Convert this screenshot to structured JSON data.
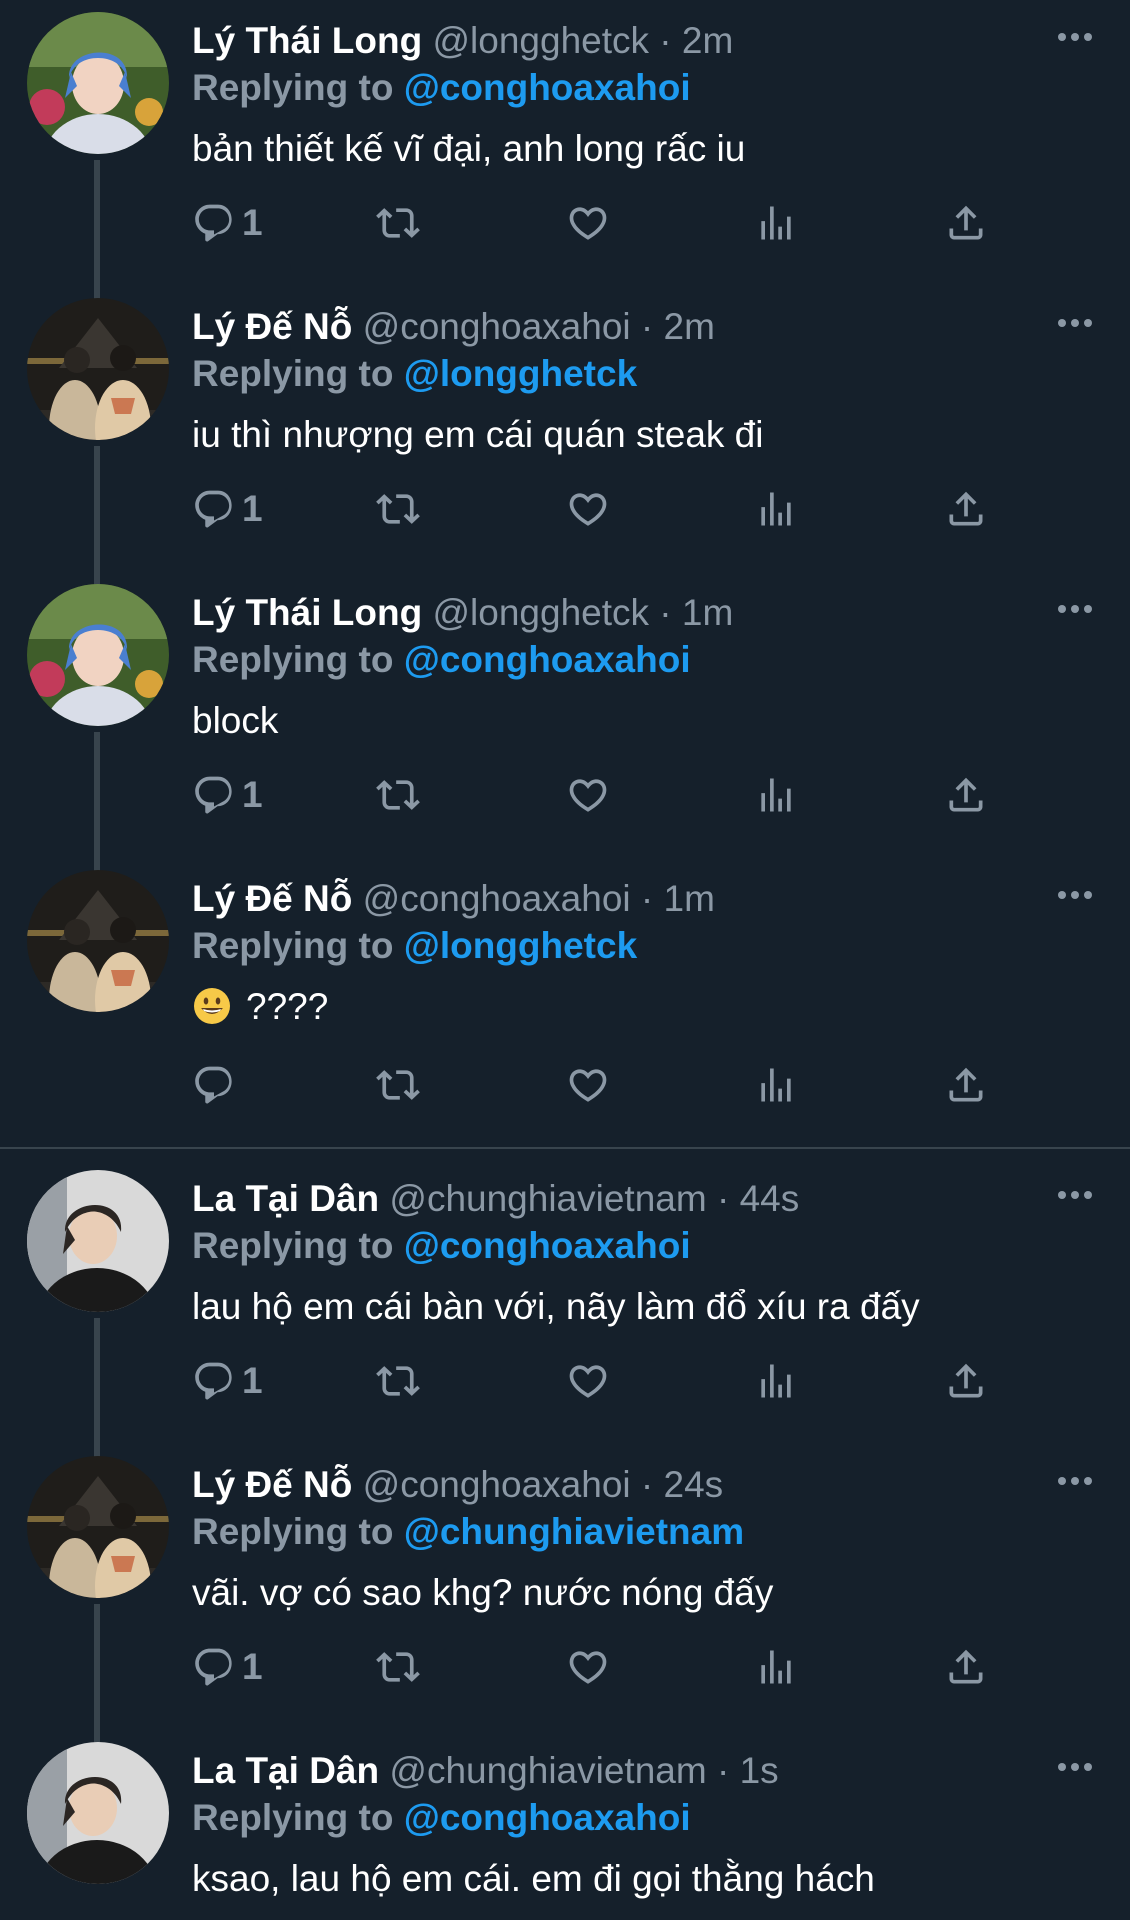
{
  "reply_prefix": "Replying to",
  "tweets": [
    {
      "name": "Lý Thái Long",
      "handle": "@longghetck",
      "dot": "·",
      "time": "2m",
      "reply_to": "@conghoaxahoi",
      "text": "bản thiết kế vĩ đại, anh long rấc iu",
      "reply_count": "1",
      "avatar_icon": "avatar-blue-hair"
    },
    {
      "name": "Lý Đế Nỗ",
      "handle": "@conghoaxahoi",
      "dot": "·",
      "time": "2m",
      "reply_to": "@longghetck",
      "text": "iu thì nhượng em cái quán steak đi",
      "reply_count": "1",
      "avatar_icon": "avatar-couple-night"
    },
    {
      "name": "Lý Thái Long",
      "handle": "@longghetck",
      "dot": "·",
      "time": "1m",
      "reply_to": "@conghoaxahoi",
      "text": "block",
      "reply_count": "1",
      "avatar_icon": "avatar-blue-hair"
    },
    {
      "name": "Lý Đế Nỗ",
      "handle": "@conghoaxahoi",
      "dot": "·",
      "time": "1m",
      "reply_to": "@longghetck",
      "text": "????",
      "emoji": "grinning-face-emoji",
      "reply_count": "",
      "avatar_icon": "avatar-couple-night"
    },
    {
      "name": "La Tại Dân",
      "handle": "@chunghiavietnam",
      "dot": "·",
      "time": "44s",
      "reply_to": "@conghoaxahoi",
      "text": "lau hộ em cái bàn với, nãy làm đổ xíu ra đấy",
      "reply_count": "1",
      "avatar_icon": "avatar-dark-hoodie"
    },
    {
      "name": "Lý Đế Nỗ",
      "handle": "@conghoaxahoi",
      "dot": "·",
      "time": "24s",
      "reply_to": "@chunghiavietnam",
      "text": "vãi. vợ có sao khg? nước nóng đấy",
      "reply_count": "1",
      "avatar_icon": "avatar-couple-night"
    },
    {
      "name": "La Tại Dân",
      "handle": "@chunghiavietnam",
      "dot": "·",
      "time": "1s",
      "reply_to": "@conghoaxahoi",
      "text": "ksao, lau hộ em cái. em đi gọi thằng hách",
      "reply_count": "",
      "avatar_icon": "avatar-dark-hoodie"
    }
  ],
  "colors": {
    "background": "#15202b",
    "accent": "#1d9bf0",
    "secondary": "#8b98a5",
    "line": "#38444d"
  }
}
